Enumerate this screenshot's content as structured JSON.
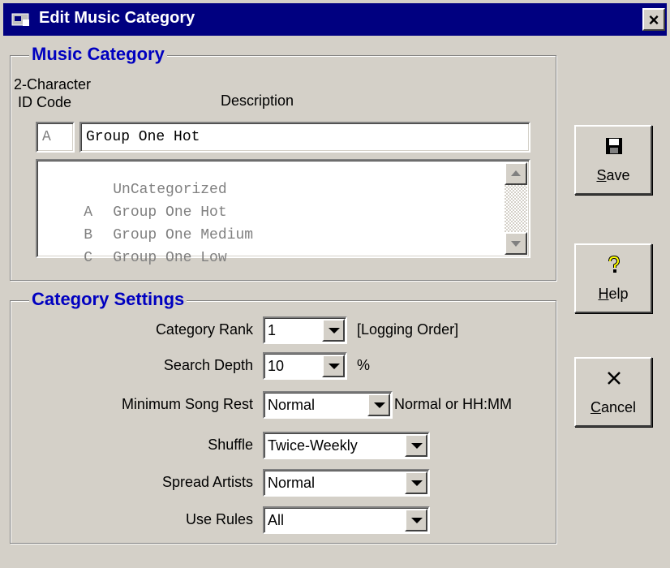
{
  "window": {
    "title": "Edit Music Category",
    "close_label": "×"
  },
  "music_category": {
    "legend": "Music Category",
    "id_header_line1": "2-Character",
    "id_header_line2": "ID Code",
    "description_header": "Description",
    "id_value": "A",
    "description_value": "Group One Hot",
    "list": [
      {
        "code": "",
        "name": "UnCategorized"
      },
      {
        "code": "A",
        "name": "Group One Hot"
      },
      {
        "code": "B",
        "name": "Group One Medium"
      },
      {
        "code": "C",
        "name": "Group One Low"
      }
    ]
  },
  "category_settings": {
    "legend": "Category Settings",
    "fields": [
      {
        "label": "Category Rank",
        "value": "1",
        "suffix": "[Logging Order]"
      },
      {
        "label": "Search Depth",
        "value": "10",
        "suffix": "%"
      },
      {
        "label": "Minimum Song Rest",
        "value": "Normal",
        "suffix": "Normal or HH:MM"
      },
      {
        "label": "Shuffle",
        "value": "Twice-Weekly",
        "suffix": ""
      },
      {
        "label": "Spread Artists",
        "value": "Normal",
        "suffix": ""
      },
      {
        "label": "Use Rules",
        "value": "All",
        "suffix": ""
      }
    ]
  },
  "buttons": {
    "save": {
      "accel": "S",
      "rest": "ave",
      "icon": "floppy-disk-icon"
    },
    "help": {
      "accel": "H",
      "rest": "elp",
      "icon": "question-mark-icon"
    },
    "cancel": {
      "accel": "C",
      "rest": "ancel",
      "icon": "x-icon"
    }
  }
}
